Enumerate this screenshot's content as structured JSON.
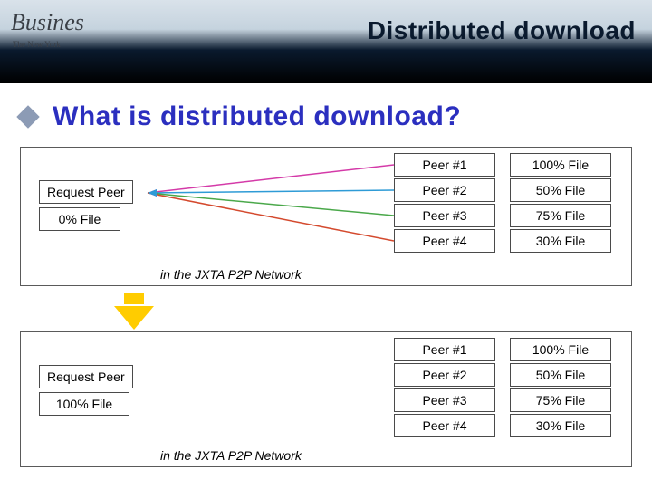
{
  "header": {
    "title": "Distributed download",
    "biz": "Busines",
    "sub": "The New York"
  },
  "heading": "What is distributed download?",
  "panels": [
    {
      "request_label": "Request Peer",
      "request_file": "0% File",
      "peers": [
        {
          "name": "Peer #1",
          "file": "100% File"
        },
        {
          "name": "Peer #2",
          "file": "50% File"
        },
        {
          "name": "Peer #3",
          "file": "75% File"
        },
        {
          "name": "Peer #4",
          "file": "30% File"
        }
      ],
      "caption": "in the JXTA P2P Network"
    },
    {
      "request_label": "Request Peer",
      "request_file": "100% File",
      "peers": [
        {
          "name": "Peer #1",
          "file": "100% File"
        },
        {
          "name": "Peer #2",
          "file": "50% File"
        },
        {
          "name": "Peer #3",
          "file": "75% File"
        },
        {
          "name": "Peer #4",
          "file": "30% File"
        }
      ],
      "caption": "in the JXTA P2P Network"
    }
  ],
  "line_colors": [
    "#d43aa8",
    "#2e9bd6",
    "#4aa84a",
    "#d44a2e"
  ]
}
